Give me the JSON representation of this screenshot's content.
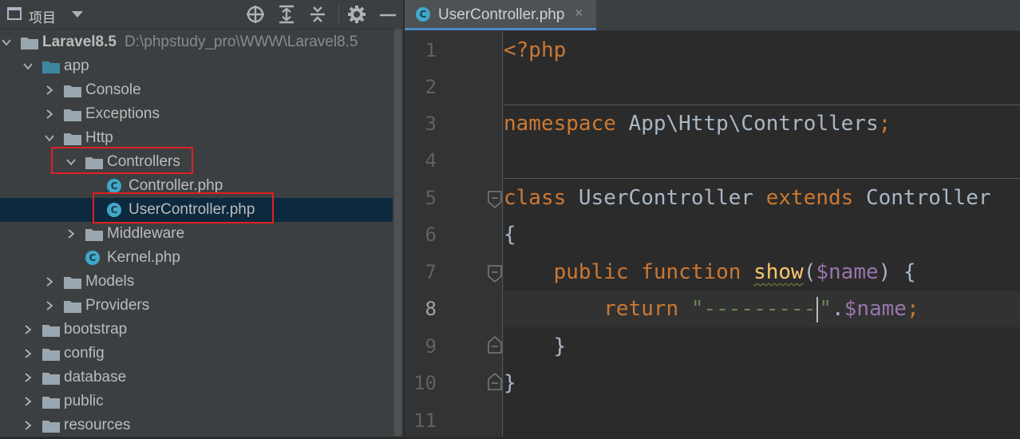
{
  "project_panel": {
    "title": "项目",
    "tree": [
      {
        "label": "Laravel8.5",
        "path": "D:\\phpstudy_pro\\WWW\\Laravel8.5",
        "type": "folder",
        "expanded": true
      },
      {
        "label": "app",
        "type": "folder",
        "expanded": true
      },
      {
        "label": "Console",
        "type": "folder",
        "expanded": false
      },
      {
        "label": "Exceptions",
        "type": "folder",
        "expanded": false
      },
      {
        "label": "Http",
        "type": "folder",
        "expanded": true
      },
      {
        "label": "Controllers",
        "type": "folder",
        "expanded": true
      },
      {
        "label": "Controller.php",
        "type": "php-class"
      },
      {
        "label": "UserController.php",
        "type": "php-class",
        "selected": true
      },
      {
        "label": "Middleware",
        "type": "folder",
        "expanded": false
      },
      {
        "label": "Kernel.php",
        "type": "php-class"
      },
      {
        "label": "Models",
        "type": "folder",
        "expanded": false
      },
      {
        "label": "Providers",
        "type": "folder",
        "expanded": false
      },
      {
        "label": "bootstrap",
        "type": "folder",
        "expanded": false
      },
      {
        "label": "config",
        "type": "folder",
        "expanded": false
      },
      {
        "label": "database",
        "type": "folder",
        "expanded": false
      },
      {
        "label": "public",
        "type": "folder",
        "expanded": false
      },
      {
        "label": "resources",
        "type": "folder",
        "expanded": false
      }
    ],
    "toolbar_icons": [
      "locate-icon",
      "expand-all-icon",
      "collapse-all-icon",
      "gear-icon",
      "minimize-icon"
    ]
  },
  "editor": {
    "tab_label": "UserController.php",
    "tab_close": "×",
    "tab_icon": "C",
    "line_numbers": [
      "1",
      "2",
      "3",
      "4",
      "5",
      "6",
      "7",
      "8",
      "9",
      "10",
      "11"
    ],
    "current_line": "8",
    "code": {
      "l1_tag": "<?php",
      "l3_kw": "namespace",
      "l3_ns": " App\\Http\\Controllers",
      "l3_semi": ";",
      "l5_class": "class",
      "l5_name": " UserController ",
      "l5_extends": "extends",
      "l5_parent": " Controller",
      "l6_brace": "{",
      "l7_public": "public",
      "l7_function": "function",
      "l7_name": "show",
      "l7_open": "(",
      "l7_param": "$name",
      "l7_close": ") {",
      "l8_return": "return",
      "l8_str_a": "\"---------",
      "l8_str_b": "\"",
      "l8_dot": ".",
      "l8_var": "$name",
      "l8_semi": ";",
      "l9_brace": "}",
      "l10_brace": "}"
    }
  },
  "colors": {
    "keyword": "#cc7832",
    "function": "#ffc66d",
    "variable": "#9876aa",
    "string": "#6a8759",
    "text": "#a9b7c6",
    "selection": "#0d293e",
    "highlight_box": "#e02020"
  }
}
